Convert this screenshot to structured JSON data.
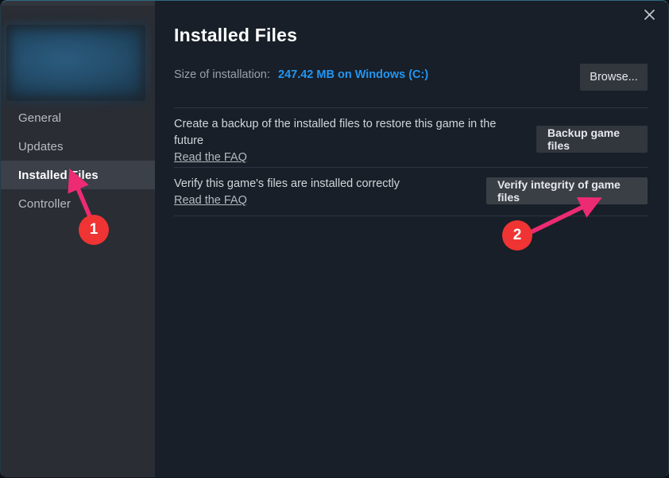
{
  "window": {
    "accent_border": "#2e6a80",
    "sidebar_bg": "#2a2d34",
    "main_bg": "#181f28",
    "link_color": "#2196f3",
    "marker_color": "#f03434"
  },
  "sidebar": {
    "capsule_alt": "game-capsule-artwork",
    "items": [
      {
        "label": "General",
        "selected": false
      },
      {
        "label": "Updates",
        "selected": false
      },
      {
        "label": "Installed Files",
        "selected": true
      },
      {
        "label": "Controller",
        "selected": false
      }
    ]
  },
  "header": {
    "title": "Installed Files",
    "close_icon": "close-icon"
  },
  "main": {
    "size_row": {
      "label": "Size of installation:",
      "value": "247.42 MB on Windows (C:)",
      "browse_label": "Browse..."
    },
    "backup_row": {
      "description": "Create a backup of the installed files to restore this game in the future",
      "faq_label": "Read the FAQ",
      "button_label": "Backup game files"
    },
    "verify_row": {
      "description": "Verify this game's files are installed correctly",
      "faq_label": "Read the FAQ",
      "button_label": "Verify integrity of game files"
    }
  },
  "annotations": [
    {
      "number": "1",
      "target": "sidebar-item-installed-files"
    },
    {
      "number": "2",
      "target": "verify-integrity-button"
    }
  ]
}
